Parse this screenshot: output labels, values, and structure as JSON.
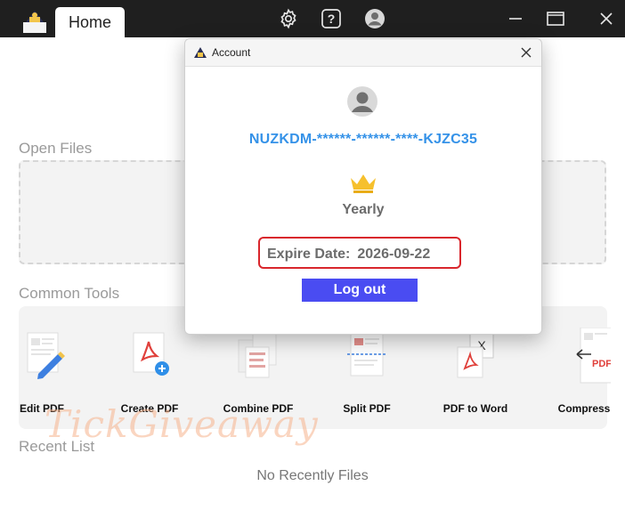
{
  "titlebar": {
    "tabs": [
      {
        "label": "Home"
      }
    ],
    "icons": [
      "settings-icon",
      "help-icon",
      "account-icon"
    ],
    "window_controls": [
      "minimize-icon",
      "maximize-icon",
      "close-icon"
    ]
  },
  "main": {
    "open_files_title": "Open Files",
    "common_tools_title": "Common Tools",
    "tools": [
      {
        "label": "Edit PDF",
        "icon": "edit-pdf-icon"
      },
      {
        "label": "Create PDF",
        "icon": "create-pdf-icon"
      },
      {
        "label": "Combine PDF",
        "icon": "combine-pdf-icon"
      },
      {
        "label": "Split PDF",
        "icon": "split-pdf-icon"
      },
      {
        "label": "PDF to Word",
        "icon": "pdf-to-word-icon"
      },
      {
        "label": "Compress",
        "icon": "compress-icon"
      }
    ],
    "recent_title": "Recent List",
    "recent_empty": "No Recently Files",
    "watermark": "TickGiveaway"
  },
  "dialog": {
    "title": "Account",
    "license_key": "NUZKDM-******-******-****-KJZC35",
    "plan": "Yearly",
    "expire_label": "Expire Date:",
    "expire_value": "2026-09-22",
    "logout_label": "Log out"
  },
  "colors": {
    "titlebar": "#1f1f1f",
    "license_blue": "#3592e8",
    "logout_button": "#4a4cf2",
    "highlight_red": "#d9262c",
    "crown_gold": "#f6c02d"
  }
}
